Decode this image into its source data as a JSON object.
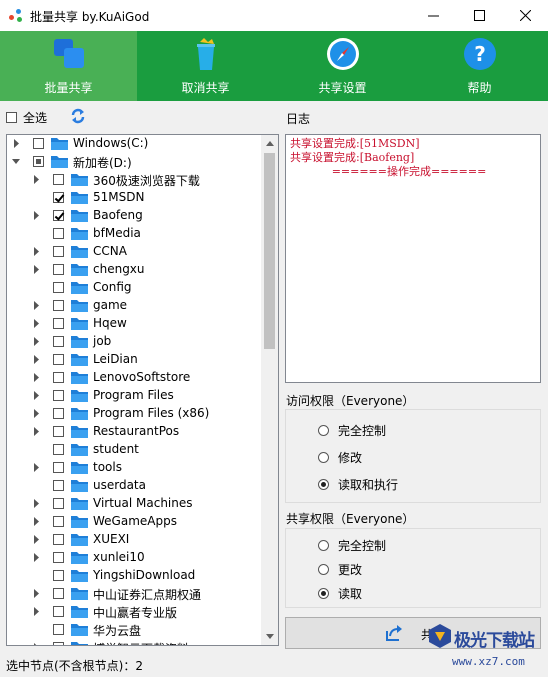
{
  "window": {
    "title": "批量共享 by.KuAiGod"
  },
  "toolbar": {
    "items": [
      {
        "label": "批量共享",
        "icon": "windows-share-icon",
        "active": true
      },
      {
        "label": "取消共享",
        "icon": "trash-bin-icon",
        "active": false
      },
      {
        "label": "共享设置",
        "icon": "compass-icon",
        "active": false
      },
      {
        "label": "帮助",
        "icon": "help-question-icon",
        "active": false
      }
    ]
  },
  "select_all": {
    "label": "全选",
    "checked": false
  },
  "tree": {
    "items": [
      {
        "label": "Windows(C:)",
        "depth": 0,
        "expanded": false,
        "state": "unchecked"
      },
      {
        "label": "新加卷(D:)",
        "depth": 0,
        "expanded": true,
        "state": "partial"
      },
      {
        "label": "360极速浏览器下载",
        "depth": 1,
        "expandable": true,
        "state": "unchecked"
      },
      {
        "label": "51MSDN",
        "depth": 1,
        "expandable": false,
        "state": "checked"
      },
      {
        "label": "Baofeng",
        "depth": 1,
        "expandable": true,
        "state": "checked"
      },
      {
        "label": "bfMedia",
        "depth": 1,
        "expandable": false,
        "state": "unchecked"
      },
      {
        "label": "CCNA",
        "depth": 1,
        "expandable": true,
        "state": "unchecked"
      },
      {
        "label": "chengxu",
        "depth": 1,
        "expandable": true,
        "state": "unchecked"
      },
      {
        "label": "Config",
        "depth": 1,
        "expandable": false,
        "state": "unchecked"
      },
      {
        "label": "game",
        "depth": 1,
        "expandable": true,
        "state": "unchecked"
      },
      {
        "label": "Hqew",
        "depth": 1,
        "expandable": true,
        "state": "unchecked"
      },
      {
        "label": "job",
        "depth": 1,
        "expandable": true,
        "state": "unchecked"
      },
      {
        "label": "LeiDian",
        "depth": 1,
        "expandable": true,
        "state": "unchecked"
      },
      {
        "label": "LenovoSoftstore",
        "depth": 1,
        "expandable": true,
        "state": "unchecked"
      },
      {
        "label": "Program Files",
        "depth": 1,
        "expandable": true,
        "state": "unchecked"
      },
      {
        "label": "Program Files (x86)",
        "depth": 1,
        "expandable": true,
        "state": "unchecked"
      },
      {
        "label": "RestaurantPos",
        "depth": 1,
        "expandable": true,
        "state": "unchecked"
      },
      {
        "label": "student",
        "depth": 1,
        "expandable": false,
        "state": "unchecked"
      },
      {
        "label": "tools",
        "depth": 1,
        "expandable": true,
        "state": "unchecked"
      },
      {
        "label": "userdata",
        "depth": 1,
        "expandable": false,
        "state": "unchecked"
      },
      {
        "label": "Virtual Machines",
        "depth": 1,
        "expandable": true,
        "state": "unchecked"
      },
      {
        "label": "WeGameApps",
        "depth": 1,
        "expandable": true,
        "state": "unchecked"
      },
      {
        "label": "XUEXI",
        "depth": 1,
        "expandable": true,
        "state": "unchecked"
      },
      {
        "label": "xunlei10",
        "depth": 1,
        "expandable": true,
        "state": "unchecked"
      },
      {
        "label": "YingshiDownload",
        "depth": 1,
        "expandable": false,
        "state": "unchecked"
      },
      {
        "label": "中山证券汇点期权通",
        "depth": 1,
        "expandable": true,
        "state": "unchecked"
      },
      {
        "label": "中山赢者专业版",
        "depth": 1,
        "expandable": true,
        "state": "unchecked"
      },
      {
        "label": "华为云盘",
        "depth": 1,
        "expandable": false,
        "state": "unchecked"
      },
      {
        "label": "博学智云下载资料",
        "depth": 1,
        "expandable": true,
        "state": "unchecked"
      }
    ]
  },
  "log": {
    "title": "日志",
    "lines": [
      {
        "text": "共享设置完成:[51MSDN]",
        "align": "left"
      },
      {
        "text": "共享设置完成:[Baofeng]",
        "align": "left"
      },
      {
        "text": "======操作完成======",
        "align": "center"
      }
    ]
  },
  "access": {
    "title": "访问权限（Everyone）",
    "options": [
      {
        "label": "完全控制",
        "selected": false
      },
      {
        "label": "修改",
        "selected": false
      },
      {
        "label": "读取和执行",
        "selected": true
      }
    ]
  },
  "share_perm": {
    "title": "共享权限（Everyone）",
    "options": [
      {
        "label": "完全控制",
        "selected": false
      },
      {
        "label": "更改",
        "selected": false
      },
      {
        "label": "读取",
        "selected": true
      }
    ]
  },
  "share_button": {
    "label": "共享"
  },
  "status": {
    "text": "选中节点(不含根节点)：2"
  },
  "watermark": {
    "text": "极光下载站",
    "url": "www.xz7.com"
  },
  "colors": {
    "toolbar": "#1a9d3f",
    "toolbar_active": "#49b055",
    "log_text": "#c8102e"
  }
}
